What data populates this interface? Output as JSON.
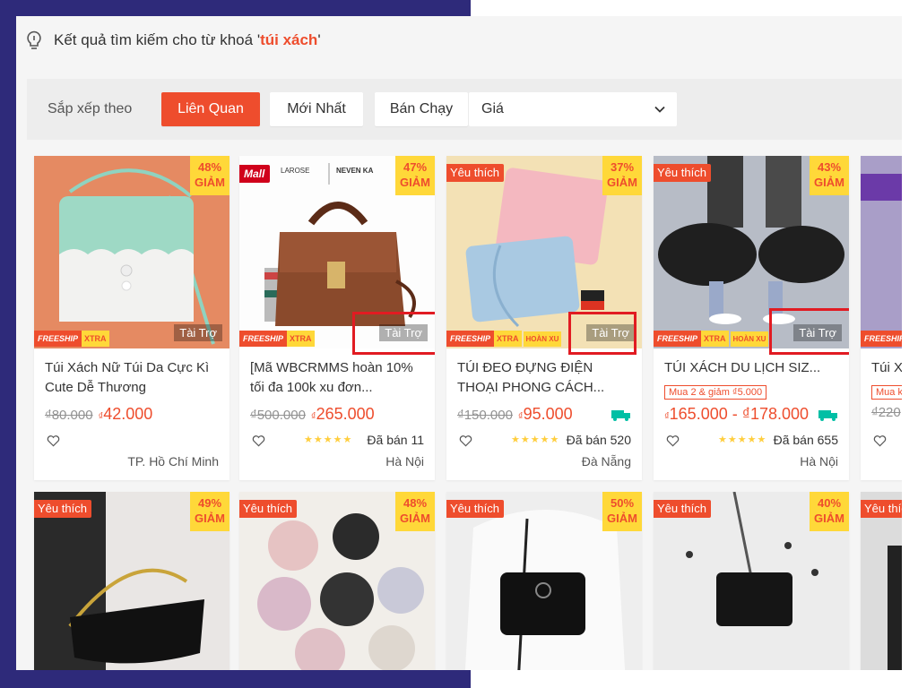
{
  "search": {
    "prefix": "Kết quả tìm kiếm cho từ khoá '",
    "keyword": "túi xách",
    "suffix": "'"
  },
  "sort": {
    "label": "Sắp xếp theo",
    "options": [
      "Liên Quan",
      "Mới Nhất",
      "Bán Chạy"
    ],
    "active": "Liên Quan",
    "price_label": "Giá"
  },
  "colors": {
    "accent": "#ee4d2d",
    "badge_yellow": "#ffd839",
    "highlight_box": "#e11b22",
    "bg_left": "#2e2a7a"
  },
  "products": [
    {
      "discount_pct": "48%",
      "discount_label": "GIẢM",
      "title": "Túi Xách Nữ Túi Da Cực Kì Cute Dễ Thương",
      "old_price": "₫80.000",
      "price_currency": "₫",
      "price": "42.000",
      "freeship": "FREESHIP",
      "xtra": "XTRA",
      "sponsored": "Tài Trợ",
      "location": "TP. Hồ Chí Minh"
    },
    {
      "discount_pct": "47%",
      "discount_label": "GIẢM",
      "mall": "Mall",
      "brand": "LAROSE",
      "brand2": "NEVEN KA",
      "title": "[Mã WBCRMMS hoàn 10% tối đa 100k xu đơn...",
      "old_price": "₫500.000",
      "price_currency": "₫",
      "price": "265.000",
      "freeship": "FREESHIP",
      "xtra": "XTRA",
      "sponsored": "Tài Trợ",
      "stars": "★★★★★",
      "sold": "Đã bán 11",
      "location": "Hà Nội"
    },
    {
      "discount_pct": "37%",
      "discount_label": "GIẢM",
      "favorite": "Yêu thích",
      "title": "TÚI ĐEO ĐỰNG ĐIỆN THOẠI PHONG CÁCH...",
      "old_price": "₫150.000",
      "price_currency": "₫",
      "price": "95.000",
      "freeship": "FREESHIP",
      "xtra": "XTRA",
      "hoan_xu": "HOÀN XU",
      "free_icon": "Free",
      "sponsored": "Tài Trợ",
      "stars": "★★★★★",
      "sold": "Đã bán 520",
      "location": "Đà Nẵng"
    },
    {
      "discount_pct": "43%",
      "discount_label": "GIẢM",
      "favorite": "Yêu thích",
      "title": "TÚI XÁCH DU LỊCH SIZ...",
      "promo": "Mua 2 & giảm ₫5.000",
      "price_currency": "₫",
      "price": "165.000 - ₫178.000",
      "freeship": "FREESHIP",
      "xtra": "XTRA",
      "hoan_xu": "HOÀN XU",
      "free_icon": "Free",
      "sponsored": "Tài Trợ",
      "stars": "★★★★★",
      "sold": "Đã bán 655",
      "location": "Hà Nội"
    },
    {
      "title": "Túi X",
      "promo": "Mua k",
      "old_price": "₫220",
      "freeship": "FREESHIP"
    }
  ],
  "products_row2": [
    {
      "favorite": "Yêu thích",
      "discount_pct": "49%",
      "discount_label": "GIẢM"
    },
    {
      "favorite": "Yêu thích",
      "discount_pct": "48%",
      "discount_label": "GIẢM"
    },
    {
      "favorite": "Yêu thích",
      "discount_pct": "50%",
      "discount_label": "GIẢM"
    },
    {
      "favorite": "Yêu thích",
      "discount_pct": "40%",
      "discount_label": "GIẢM"
    },
    {
      "favorite": "Yêu thíc"
    }
  ]
}
